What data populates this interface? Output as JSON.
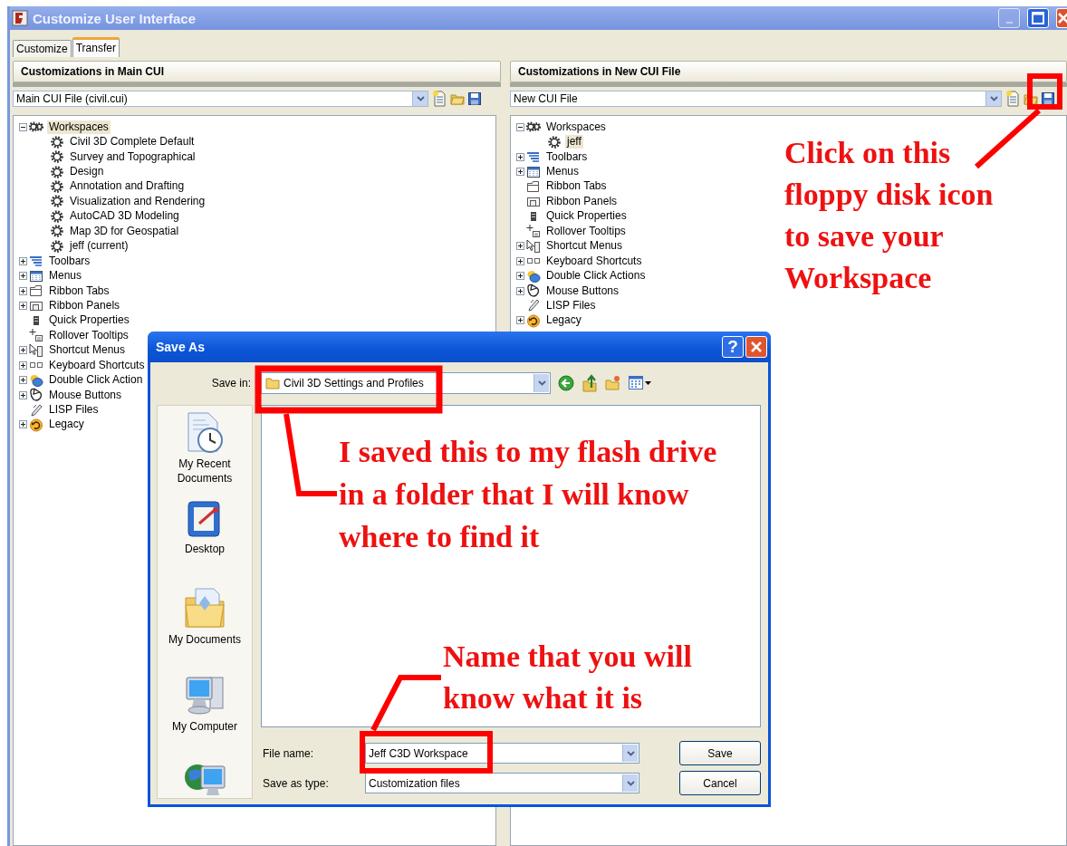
{
  "window": {
    "title": "Customize User Interface"
  },
  "tabs": [
    {
      "label": "Customize",
      "selected": false
    },
    {
      "label": "Transfer",
      "selected": true
    }
  ],
  "panels": [
    {
      "title": "Customizations in Main CUI",
      "file": "Main CUI File (civil.cui)",
      "tree": [
        {
          "label": "Workspaces",
          "kind": "workspaces",
          "expanded": true,
          "selected": true,
          "children": [
            {
              "label": "Civil 3D Complete Default",
              "kind": "workspace",
              "selected": false
            },
            {
              "label": "Survey and Topographical",
              "kind": "workspace",
              "selected": false
            },
            {
              "label": "Design",
              "kind": "workspace",
              "selected": false
            },
            {
              "label": "Annotation and Drafting",
              "kind": "workspace",
              "selected": false
            },
            {
              "label": "Visualization and Rendering",
              "kind": "workspace",
              "selected": false
            },
            {
              "label": "AutoCAD 3D Modeling",
              "kind": "workspace",
              "selected": false
            },
            {
              "label": "Map 3D for Geospatial",
              "kind": "workspace",
              "selected": false
            },
            {
              "label": "jeff (current)",
              "kind": "workspace",
              "selected": false
            }
          ]
        },
        {
          "label": "Toolbars",
          "kind": "toolbars",
          "expanded": false,
          "selected": false
        },
        {
          "label": "Menus",
          "kind": "menus",
          "expanded": false,
          "selected": false
        },
        {
          "label": "Ribbon Tabs",
          "kind": "ribbon-tabs",
          "expanded": false,
          "selected": false
        },
        {
          "label": "Ribbon Panels",
          "kind": "ribbon-panels",
          "expanded": false,
          "selected": false
        },
        {
          "label": "Quick Properties",
          "kind": "quick-properties",
          "selected": false
        },
        {
          "label": "Rollover Tooltips",
          "kind": "rollover-tooltips",
          "selected": false
        },
        {
          "label": "Shortcut Menus",
          "kind": "shortcut-menus",
          "expanded": false,
          "selected": false
        },
        {
          "label": "Keyboard Shortcuts",
          "kind": "keyboard-shortcuts",
          "expanded": false,
          "selected": false
        },
        {
          "label": "Double Click Action",
          "kind": "double-click-actions",
          "expanded": false,
          "selected": false
        },
        {
          "label": "Mouse Buttons",
          "kind": "mouse-buttons",
          "expanded": false,
          "selected": false
        },
        {
          "label": "LISP Files",
          "kind": "lisp-files",
          "selected": false
        },
        {
          "label": "Legacy",
          "kind": "legacy",
          "expanded": false,
          "selected": false
        }
      ]
    },
    {
      "title": "Customizations in New CUI File",
      "file": "New CUI File",
      "tree": [
        {
          "label": "Workspaces",
          "kind": "workspaces",
          "expanded": true,
          "selected": false,
          "children": [
            {
              "label": "jeff",
              "kind": "workspace",
              "selected": true
            }
          ]
        },
        {
          "label": "Toolbars",
          "kind": "toolbars",
          "expanded": false,
          "selected": false
        },
        {
          "label": "Menus",
          "kind": "menus",
          "expanded": false,
          "selected": false
        },
        {
          "label": "Ribbon Tabs",
          "kind": "ribbon-tabs",
          "selected": false
        },
        {
          "label": "Ribbon Panels",
          "kind": "ribbon-panels",
          "selected": false
        },
        {
          "label": "Quick Properties",
          "kind": "quick-properties",
          "selected": false
        },
        {
          "label": "Rollover Tooltips",
          "kind": "rollover-tooltips",
          "selected": false
        },
        {
          "label": "Shortcut Menus",
          "kind": "shortcut-menus",
          "expanded": false,
          "selected": false
        },
        {
          "label": "Keyboard Shortcuts",
          "kind": "keyboard-shortcuts",
          "expanded": false,
          "selected": false
        },
        {
          "label": "Double Click Actions",
          "kind": "double-click-actions",
          "expanded": false,
          "selected": false
        },
        {
          "label": "Mouse Buttons",
          "kind": "mouse-buttons",
          "expanded": false,
          "selected": false
        },
        {
          "label": "LISP Files",
          "kind": "lisp-files",
          "selected": false
        },
        {
          "label": "Legacy",
          "kind": "legacy",
          "expanded": false,
          "selected": false
        }
      ]
    }
  ],
  "dialog": {
    "title": "Save As",
    "help": "?",
    "save_in": {
      "label": "Save in:",
      "value": "Civil 3D Settings and Profiles"
    },
    "places": [
      {
        "kind": "recent",
        "label": "My Recent Documents"
      },
      {
        "kind": "desktop",
        "label": "Desktop"
      },
      {
        "kind": "documents",
        "label": "My Documents"
      },
      {
        "kind": "computer",
        "label": "My Computer"
      },
      {
        "kind": "network"
      }
    ],
    "file_name": {
      "label": "File name:",
      "value": "Jeff C3D Workspace"
    },
    "file_type": {
      "label": "Save as type:",
      "value": "Customization files"
    },
    "buttons": [
      "Save",
      "Cancel"
    ]
  },
  "annotations": [
    {
      "text": "Click on this\nfloppy disk icon\nto save your\nWorkspace"
    },
    {
      "text": "I saved this to my flash drive\nin a folder that I will know\nwhere to find it"
    },
    {
      "text": "Name that you will\nknow what it is"
    }
  ]
}
